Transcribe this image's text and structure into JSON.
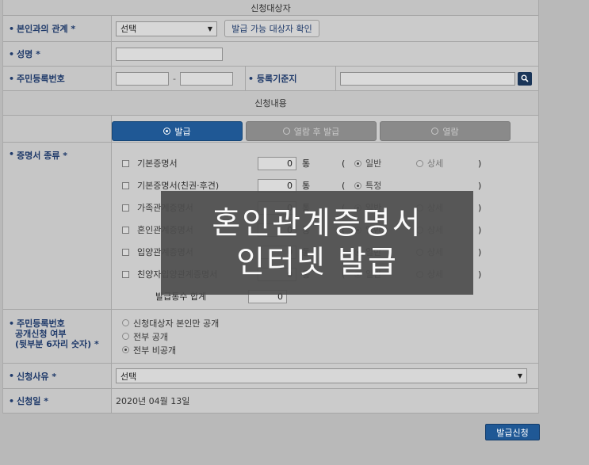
{
  "sections": {
    "applicant": "신청대상자",
    "content": "신청내용"
  },
  "relation": {
    "label": "본인과의 관계 *",
    "select_value": "선택",
    "check_button": "발급 가능 대상자 확인"
  },
  "name": {
    "label": "성명 *",
    "value": ""
  },
  "rrn": {
    "label": "주민등록번호",
    "front": "",
    "back": "",
    "dash": "-"
  },
  "reg_base": {
    "label": "등록기준지",
    "value": ""
  },
  "tabs": [
    {
      "label": "발급",
      "active": true
    },
    {
      "label": "열람 후 발급",
      "active": false
    },
    {
      "label": "열람",
      "active": false
    }
  ],
  "cert_types": {
    "label": "증명서 종류 *",
    "unit": "통",
    "paren_open": "(",
    "paren_close": ")",
    "items": [
      {
        "name": "기본증명서",
        "count": "0",
        "opt1": "일반",
        "opt2": "상세"
      },
      {
        "name": "기본증명서(친권·후견)",
        "count": "0",
        "opt1": "특정",
        "opt2": ""
      },
      {
        "name": "가족관계증명서",
        "count": "0",
        "opt1": "일반",
        "opt2": "상세"
      },
      {
        "name": "혼인관계증명서",
        "count": "0",
        "opt1": "일반",
        "opt2": "상세"
      },
      {
        "name": "입양관계증명서",
        "count": "0",
        "opt1": "일반",
        "opt2": "상세"
      },
      {
        "name": "친양자입양관계증명서",
        "count": "0",
        "opt1": "일반",
        "opt2": "상세"
      }
    ],
    "total_label": "발급통수 합계",
    "total_value": "0"
  },
  "disclosure": {
    "label_lines": [
      "주민등록번호",
      "공개신청 여부",
      "(뒷부분 6자리 숫자) *"
    ],
    "options": [
      "신청대상자 본인만 공개",
      "전부 공개",
      "전부 비공개"
    ],
    "selected": 2
  },
  "reason": {
    "label": "신청사유 *",
    "value": "선택"
  },
  "date": {
    "label": "신청일 *",
    "value": "2020년 04월 13일"
  },
  "submit_label": "발급신청",
  "overlay": {
    "line1": "혼인관계증명서",
    "line2": "인터넷 발급"
  },
  "colors": {
    "accent": "#1f5895",
    "label_text": "#1f3a6a",
    "background": "#b9b9b9"
  }
}
